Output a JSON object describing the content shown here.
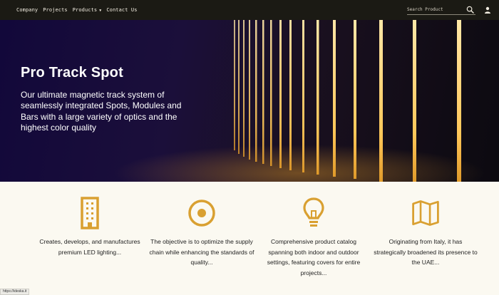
{
  "nav": {
    "items": [
      {
        "label": "Company"
      },
      {
        "label": "Projects"
      },
      {
        "label": "Products",
        "caret": "▼"
      },
      {
        "label": "Contact Us"
      }
    ]
  },
  "search": {
    "placeholder": "Search Product",
    "icon": "search-icon"
  },
  "user": {
    "icon": "user-icon"
  },
  "hero": {
    "title": "Pro Track Spot",
    "description": "Our ultimate magnetic track system of seamlessly integrated Spots, Modules and Bars with a large variety of optics and the highest color quality"
  },
  "features": [
    {
      "icon": "building-icon",
      "text": "Creates, develops, and manufactures premium LED lighting..."
    },
    {
      "icon": "target-icon",
      "text": "The objective is to optimize the supply chain while enhancing the standards of quality..."
    },
    {
      "icon": "lightbulb-icon",
      "text": "Comprehensive product catalog spanning both indoor and outdoor settings, featuring covers for entire projects..."
    },
    {
      "icon": "map-icon",
      "text": "Originating from Italy, it has strategically broadened its presence to the UAE..."
    }
  ],
  "status_url": "https://ideska.it",
  "colors": {
    "accent": "#d9a031",
    "topbar": "#1b1a14",
    "background": "#fbf9f1"
  }
}
